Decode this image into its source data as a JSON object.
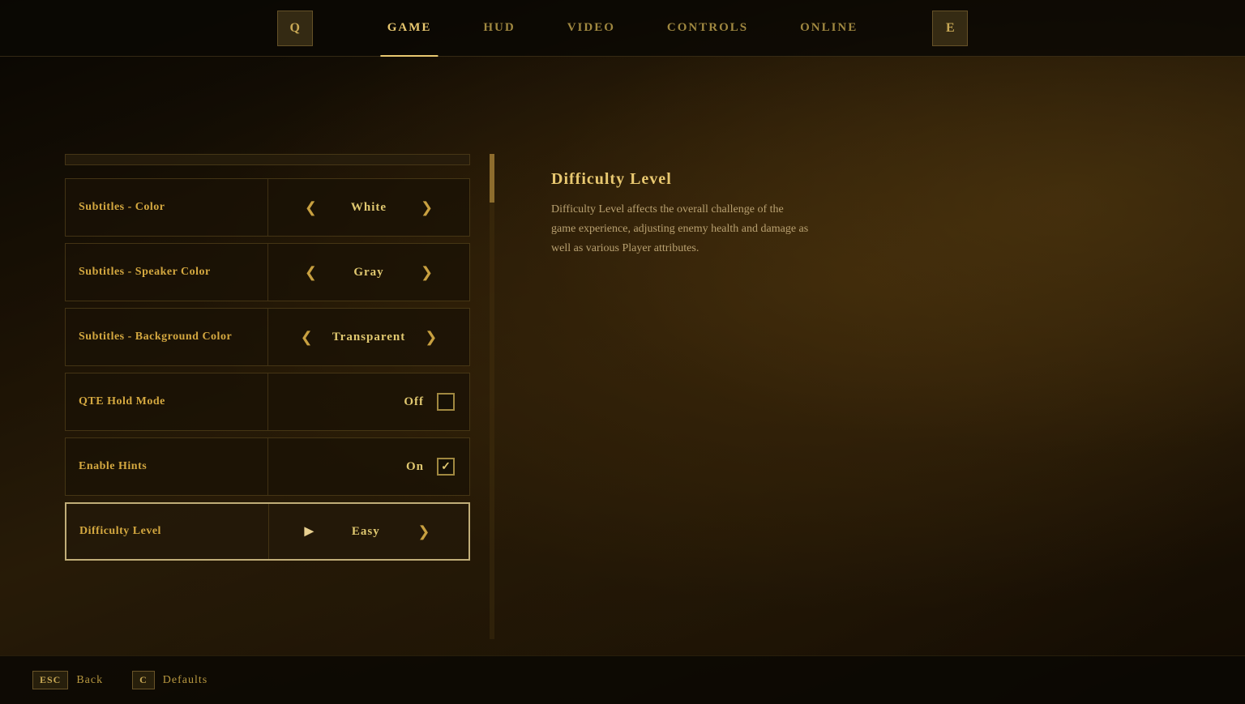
{
  "nav": {
    "icon_left": "Q",
    "icon_right": "E",
    "tabs": [
      {
        "label": "GAME",
        "active": true
      },
      {
        "label": "HUD",
        "active": false
      },
      {
        "label": "VIDEO",
        "active": false
      },
      {
        "label": "CONTROLS",
        "active": false
      },
      {
        "label": "ONLINE",
        "active": false
      }
    ]
  },
  "settings": {
    "items": [
      {
        "label": "Subtitles - Color",
        "value": "White",
        "type": "arrow",
        "active": false
      },
      {
        "label": "Subtitles - Speaker Color",
        "value": "Gray",
        "type": "arrow",
        "active": false
      },
      {
        "label": "Subtitles - Background Color",
        "value": "Transparent",
        "type": "arrow",
        "active": false
      },
      {
        "label": "QTE Hold Mode",
        "value": "Off",
        "type": "checkbox",
        "checked": false,
        "active": false
      },
      {
        "label": "Enable Hints",
        "value": "On",
        "type": "checkbox",
        "checked": true,
        "active": false
      },
      {
        "label": "Difficulty Level",
        "value": "Easy",
        "type": "arrow",
        "active": true
      }
    ]
  },
  "info": {
    "title": "Difficulty Level",
    "description": "Difficulty Level affects the overall challenge of the game experience, adjusting enemy health and damage as well as various Player attributes."
  },
  "bottom": {
    "back_key": "ESC",
    "back_label": "Back",
    "defaults_key": "C",
    "defaults_label": "Defaults"
  }
}
